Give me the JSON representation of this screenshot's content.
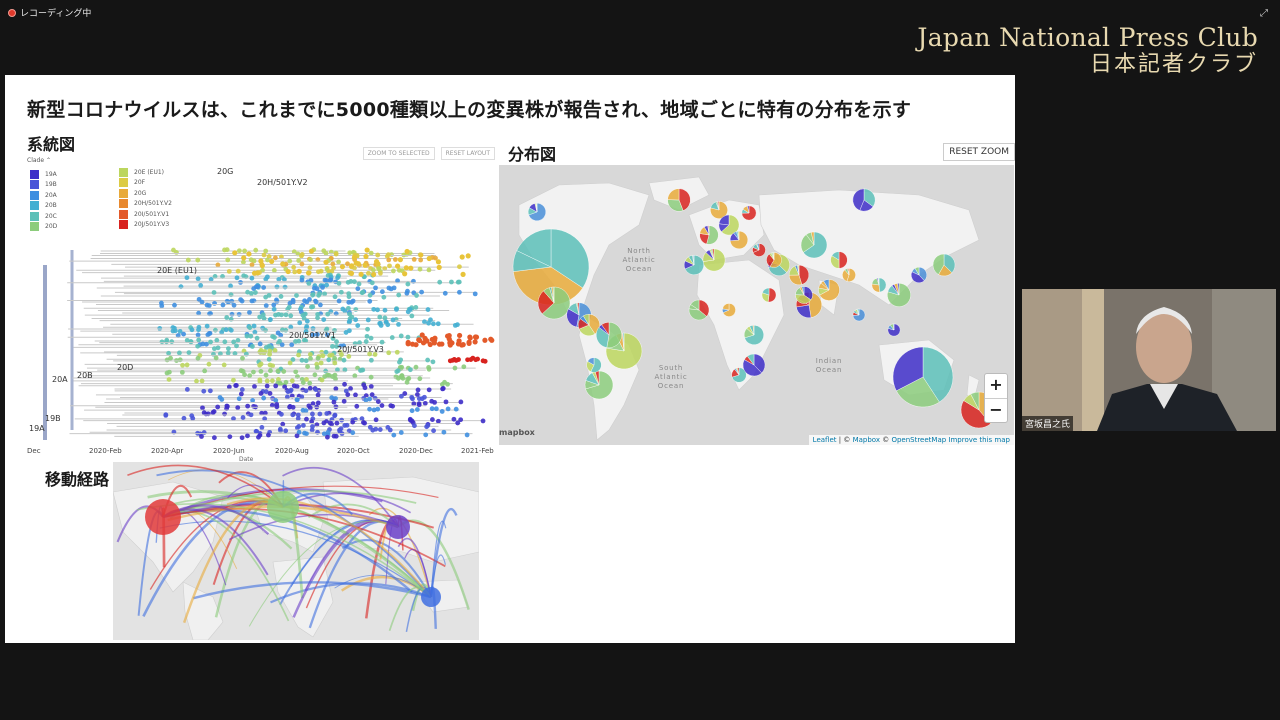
{
  "recording": {
    "label": "レコーディング中"
  },
  "logo": {
    "en": "Japan National Press Club",
    "jp": "日本記者クラブ"
  },
  "slide": {
    "title": "新型コロナウイルスは、これまでに5000種類以上の変異株が報告され、地域ごとに特有の分布を示す",
    "phylo_title": "系統図",
    "map_title": "分布図",
    "route_title": "移動経路"
  },
  "tree": {
    "buttons": [
      "ZOOM TO SELECTED",
      "RESET LAYOUT"
    ],
    "legend_title": "Clade ⌃",
    "legend_col1": [
      {
        "label": "19A",
        "color": "#3e2ec8"
      },
      {
        "label": "19B",
        "color": "#4a55d8"
      },
      {
        "label": "20A",
        "color": "#3f8fe0"
      },
      {
        "label": "20B",
        "color": "#44afd2"
      },
      {
        "label": "20C",
        "color": "#5cc0b8"
      },
      {
        "label": "20D",
        "color": "#8ccc7c"
      }
    ],
    "legend_col2": [
      {
        "label": "20E (EU1)",
        "color": "#bcd65e"
      },
      {
        "label": "20F",
        "color": "#dccb45"
      },
      {
        "label": "20G",
        "color": "#e8aa3a"
      },
      {
        "label": "20H/501Y.V2",
        "color": "#e8892f"
      },
      {
        "label": "20I/501Y.V1",
        "color": "#e35a2a"
      },
      {
        "label": "20J/501Y.V3",
        "color": "#d8231f"
      }
    ],
    "branch_labels": [
      "20G",
      "20H/501Y.V2",
      "20E (EU1)",
      "20I/501Y.V1",
      "20J/501Y.V3",
      "20D",
      "20A",
      "20B",
      "19A",
      "19B"
    ],
    "axis_ticks": [
      "Dec",
      "2020-Feb",
      "2020-Apr",
      "2020-Jun",
      "2020-Aug",
      "2020-Oct",
      "2020-Dec",
      "2021-Feb"
    ],
    "axis_label": "Date"
  },
  "map": {
    "reset_zoom": "RESET ZOOM",
    "zoom_in": "+",
    "zoom_out": "−",
    "mapbox_logo": "mapbox",
    "attribution": {
      "leaflet": "Leaflet",
      "sep1": " | © ",
      "mapbox": "Mapbox",
      "sep2": " © ",
      "osm": "OpenStreetMap",
      "improve": " Improve this map"
    },
    "labels": [
      "North Atlantic Ocean",
      "South Atlantic Ocean",
      "Indian Ocean"
    ]
  },
  "camera": {
    "name": "宮坂昌之氏"
  }
}
